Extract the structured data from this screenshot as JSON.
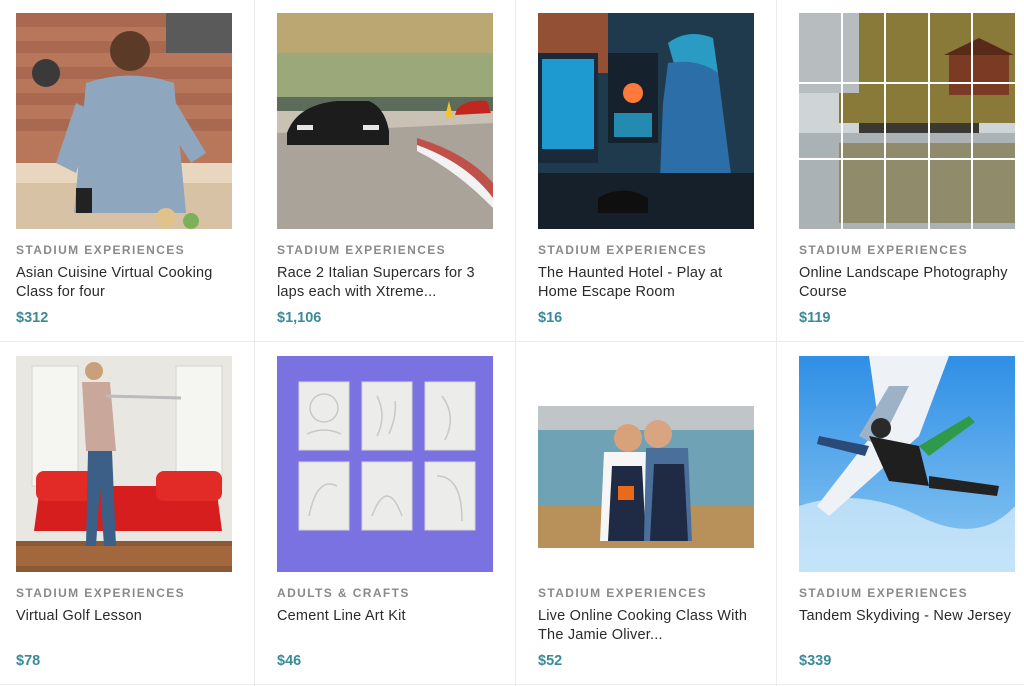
{
  "products": [
    {
      "category": "STADIUM EXPERIENCES",
      "title": "Asian Cuisine Virtual Cooking Class for four",
      "price": "$312",
      "image": "chef-cooking-kitchen"
    },
    {
      "category": "STADIUM EXPERIENCES",
      "title": "Race 2 Italian Supercars for 3 laps each with Xtreme...",
      "price": "$1,106",
      "image": "supercar-race-track"
    },
    {
      "category": "STADIUM EXPERIENCES",
      "title": "The Haunted Hotel - Play at Home Escape Room",
      "price": "$16",
      "image": "gamer-computer-setup"
    },
    {
      "category": "STADIUM EXPERIENCES",
      "title": "Online Landscape Photography Course",
      "price": "$119",
      "image": "lake-boathouse-grid"
    },
    {
      "category": "STADIUM EXPERIENCES",
      "title": "Virtual Golf Lesson",
      "price": "$78",
      "image": "man-golf-swing-living-room"
    },
    {
      "category": "ADULTS & CRAFTS",
      "title": "Cement Line Art Kit",
      "price": "$46",
      "image": "cement-art-tiles"
    },
    {
      "category": "STADIUM EXPERIENCES",
      "title": "Live Online Cooking Class With The Jamie Oliver...",
      "price": "$52",
      "image": "two-chefs-kitchen"
    },
    {
      "category": "STADIUM EXPERIENCES",
      "title": "Tandem Skydiving - New Jersey",
      "price": "$339",
      "image": "tandem-skydivers"
    }
  ],
  "colors": {
    "price": "#3b8a9a",
    "category": "#8a8a8a",
    "divider": "#ececec"
  }
}
